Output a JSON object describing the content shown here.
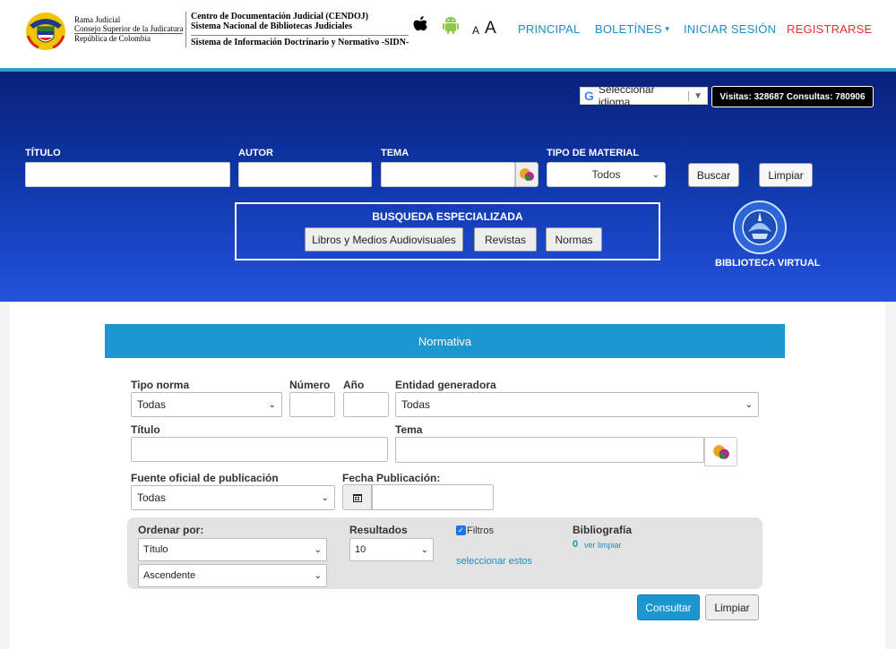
{
  "header": {
    "org_lines": [
      "Rama Judicial",
      "Consejo Superior de la Judicatura",
      "República de Colombia"
    ],
    "cendoj_lines": [
      "Centro de Documentación Judicial (CENDOJ)",
      "Sistema Nacional de Bibliotecas Judiciales"
    ],
    "sidn_line": "Sistema de Información Doctrinario y Normativo -SIDN-",
    "font_small": "A",
    "font_large": "A",
    "nav": {
      "principal": "PRINCIPAL",
      "boletines": "BOLETÍNES",
      "iniciar": "INICIAR SESIÓN",
      "registrarse": "REGISTRARSE"
    }
  },
  "hero": {
    "language_selector": "Seleccionar idioma",
    "google_g": "G",
    "visits": "Visitas: 328687 Consultas: 780906",
    "labels": {
      "titulo": "TÍTULO",
      "autor": "AUTOR",
      "tema": "TEMA",
      "tipo": "TIPO DE MATERIAL"
    },
    "tipo_value": "Todos",
    "buscar": "Buscar",
    "limpiar": "Limpiar",
    "specialized": {
      "title": "BUSQUEDA ESPECIALIZADA",
      "buttons": [
        "Libros y Medios Audiovisuales",
        "Revistas",
        "Normas"
      ]
    },
    "virtual_library": "BIBLIOTECA VIRTUAL"
  },
  "form": {
    "panel_title": "Normativa",
    "labels": {
      "tipo_norma": "Tipo norma",
      "numero": "Número",
      "anio": "Año",
      "entidad": "Entidad generadora",
      "titulo": "Título",
      "tema": "Tema",
      "fuente": "Fuente oficial de publicación",
      "fecha": "Fecha Publicación:"
    },
    "values": {
      "tipo_norma": "Todas",
      "entidad": "Todas",
      "fuente": "Todas"
    },
    "order": {
      "label": "Ordenar por:",
      "field": "Título",
      "direction": "Ascendente",
      "results_label": "Resultados",
      "results_value": "10",
      "filters_label": "Filtros",
      "filters_checked": true,
      "select_link": "seleccionar estos",
      "bib_label": "Bibliografía",
      "bib_count": "0",
      "bib_link": "ver limpiar"
    },
    "consultar": "Consultar",
    "limpiar": "Limpiar"
  },
  "colors": {
    "accent": "#1c96ce",
    "register": "#dd3333",
    "hero_top": "#09217a",
    "hero_bottom": "#2352dc"
  }
}
